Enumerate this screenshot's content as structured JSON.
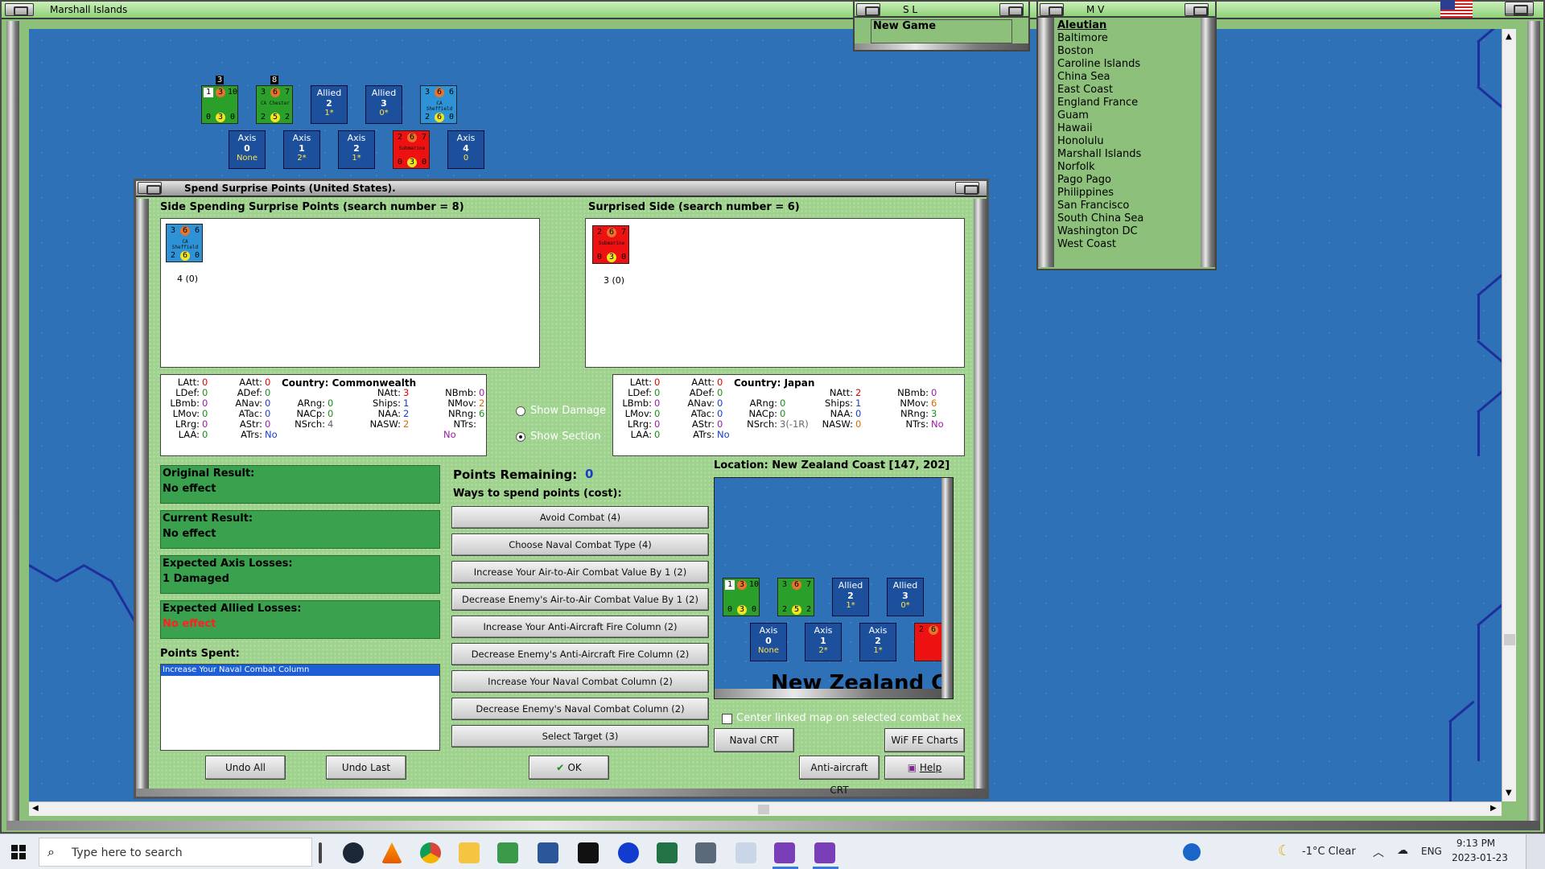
{
  "map_window": {
    "title": "Marshall Islands"
  },
  "sl_window": {
    "title": "S L",
    "value": "New Game"
  },
  "mv_window": {
    "title": "M V",
    "items": [
      "Aleutian",
      "Baltimore",
      "Boston",
      "Caroline Islands",
      "China Sea",
      "East Coast",
      "England France",
      "Guam",
      "Hawaii",
      "Honolulu",
      "Marshall Islands",
      "Norfolk",
      "Pago Pago",
      "Philippines",
      "San Francisco",
      "South China Sea",
      "Washington DC",
      "West Coast"
    ],
    "selected": "Aleutian"
  },
  "map_units": {
    "top_row": [
      {
        "type": "counter",
        "color": "green",
        "tl": "1",
        "tc": "3",
        "tr": "10",
        "bl": "0",
        "bc": "3",
        "br": "0",
        "stack": "3"
      },
      {
        "type": "counter",
        "color": "green",
        "tl": "3",
        "tc": "6",
        "tr": "7",
        "bl": "2",
        "bc": "5",
        "br": "2",
        "name": "CA Chester",
        "stack": "8"
      },
      {
        "type": "box",
        "side": "Allied",
        "value": "2",
        "sub": "1*"
      },
      {
        "type": "box",
        "side": "Allied",
        "value": "3",
        "sub": "0*"
      },
      {
        "type": "counter",
        "color": "blue",
        "tl": "3",
        "tc": "6",
        "tr": "6",
        "bl": "2",
        "bc": "6",
        "br": "0",
        "name": "CA Sheffield"
      }
    ],
    "bottom_row": [
      {
        "type": "box",
        "side": "Axis",
        "value": "0",
        "sub": "None"
      },
      {
        "type": "box",
        "side": "Axis",
        "value": "1",
        "sub": "2*"
      },
      {
        "type": "box",
        "side": "Axis",
        "value": "2",
        "sub": "1*"
      },
      {
        "type": "counter",
        "color": "red",
        "tl": "2",
        "tc": "6",
        "tr": "7",
        "bl": "0",
        "bc": "3",
        "br": "0",
        "name": "Submarine"
      },
      {
        "type": "box",
        "side": "Axis",
        "value": "4",
        "sub": "0"
      }
    ]
  },
  "dialog": {
    "title": "Spend Surprise Points (United States).",
    "left_header": "Side Spending Surprise Points (search number = 8)",
    "right_header": "Surprised Side (search number = 6)",
    "left_unit": {
      "name": "CA Sheffield",
      "tl": "3",
      "tc": "6",
      "tr": "6",
      "bl": "2",
      "bc": "6",
      "br": "0",
      "caption": "4 (0)"
    },
    "right_unit": {
      "name": "Submarine",
      "tl": "2",
      "tc": "6",
      "tr": "7",
      "bl": "0",
      "bc": "3",
      "br": "0",
      "caption": "3 (0)"
    },
    "left_stats": {
      "country_label": "Country: Commonwealth",
      "c1": [
        [
          "LAtt:",
          "0"
        ],
        [
          "LDef:",
          "0"
        ],
        [
          "LBmb:",
          "0"
        ],
        [
          "LMov:",
          "0"
        ],
        [
          "LRrg:",
          "0"
        ],
        [
          "LAA:",
          "0"
        ]
      ],
      "c2": [
        [
          "AAtt:",
          "0"
        ],
        [
          "ADef:",
          "0"
        ],
        [
          "ANav:",
          "0"
        ],
        [
          "ATac:",
          "0"
        ],
        [
          "AStr:",
          "0"
        ],
        [
          "ATrs:",
          "No"
        ]
      ],
      "c3": [
        [
          "ARng:",
          "0"
        ],
        [
          "NACp:",
          "0"
        ],
        [
          "NSrch:",
          "4"
        ]
      ],
      "c4": [
        [
          "NAtt:",
          "3"
        ],
        [
          "Ships:",
          "1"
        ],
        [
          "NAA:",
          "2"
        ],
        [
          "NASW:",
          "2"
        ]
      ],
      "c5": [
        [
          "NBmb:",
          "0"
        ],
        [
          "NMov:",
          "2"
        ],
        [
          "NRng:",
          "6"
        ],
        [
          "NTrs:",
          "No"
        ]
      ]
    },
    "right_stats": {
      "country_label": "Country: Japan",
      "c1": [
        [
          "LAtt:",
          "0"
        ],
        [
          "LDef:",
          "0"
        ],
        [
          "LBmb:",
          "0"
        ],
        [
          "LMov:",
          "0"
        ],
        [
          "LRrg:",
          "0"
        ],
        [
          "LAA:",
          "0"
        ]
      ],
      "c2": [
        [
          "AAtt:",
          "0"
        ],
        [
          "ADef:",
          "0"
        ],
        [
          "ANav:",
          "0"
        ],
        [
          "ATac:",
          "0"
        ],
        [
          "AStr:",
          "0"
        ],
        [
          "ATrs:",
          "No"
        ]
      ],
      "c3": [
        [
          "ARng:",
          "0"
        ],
        [
          "NACp:",
          "0"
        ],
        [
          "NSrch:",
          "3(-1R)"
        ]
      ],
      "c4": [
        [
          "NAtt:",
          "2"
        ],
        [
          "Ships:",
          "1"
        ],
        [
          "NAA:",
          "0"
        ],
        [
          "NASW:",
          "0"
        ]
      ],
      "c5": [
        [
          "NBmb:",
          "0"
        ],
        [
          "NMov:",
          "6"
        ],
        [
          "NRng:",
          "3"
        ],
        [
          "NTrs:",
          "No"
        ]
      ]
    },
    "show_damage": "Show Damage",
    "show_section": "Show Section",
    "results": [
      {
        "label": "Original Result:",
        "value": "No effect",
        "red": false
      },
      {
        "label": "Current Result:",
        "value": "No effect",
        "red": false
      },
      {
        "label": "Expected Axis Losses:",
        "value": "1 Damaged",
        "red": false
      },
      {
        "label": "Expected Allied Losses:",
        "value": "No effect",
        "red": true
      }
    ],
    "points_spent_label": "Points Spent:",
    "points_spent_items": [
      "Increase Your Naval Combat Column"
    ],
    "points_remaining_label": "Points Remaining:",
    "points_remaining_value": "0",
    "ways_label": "Ways to spend points (cost):",
    "spend_options": [
      "Avoid Combat (4)",
      "Choose Naval Combat Type (4)",
      "Increase Your Air-to-Air Combat Value By 1 (2)",
      "Decrease Enemy's Air-to-Air Combat Value By 1 (2)",
      "Increase Your Anti-Aircraft Fire Column (2)",
      "Decrease Enemy's Anti-Aircraft Fire Column (2)",
      "Increase Your Naval Combat Column (2)",
      "Decrease Enemy's Naval Combat Column (2)",
      "Select Target (3)"
    ],
    "location_label": "Location: New Zealand Coast [147, 202]",
    "mini_map_text": "New Zealand C",
    "center_linked_label": "Center linked map on selected combat hex",
    "buttons": {
      "undo_all": "Undo All",
      "undo_last": "Undo Last",
      "ok": "OK",
      "naval_crt": "Naval CRT",
      "wif_fe_charts": "WiF FE Charts",
      "aa_crt": "Anti-aircraft CRT",
      "help": "Help"
    }
  },
  "taskbar": {
    "search_placeholder": "Type here to search",
    "weather": "-1°C  Clear",
    "lang": "ENG",
    "time": "9:13 PM",
    "date": "2023-01-23"
  }
}
